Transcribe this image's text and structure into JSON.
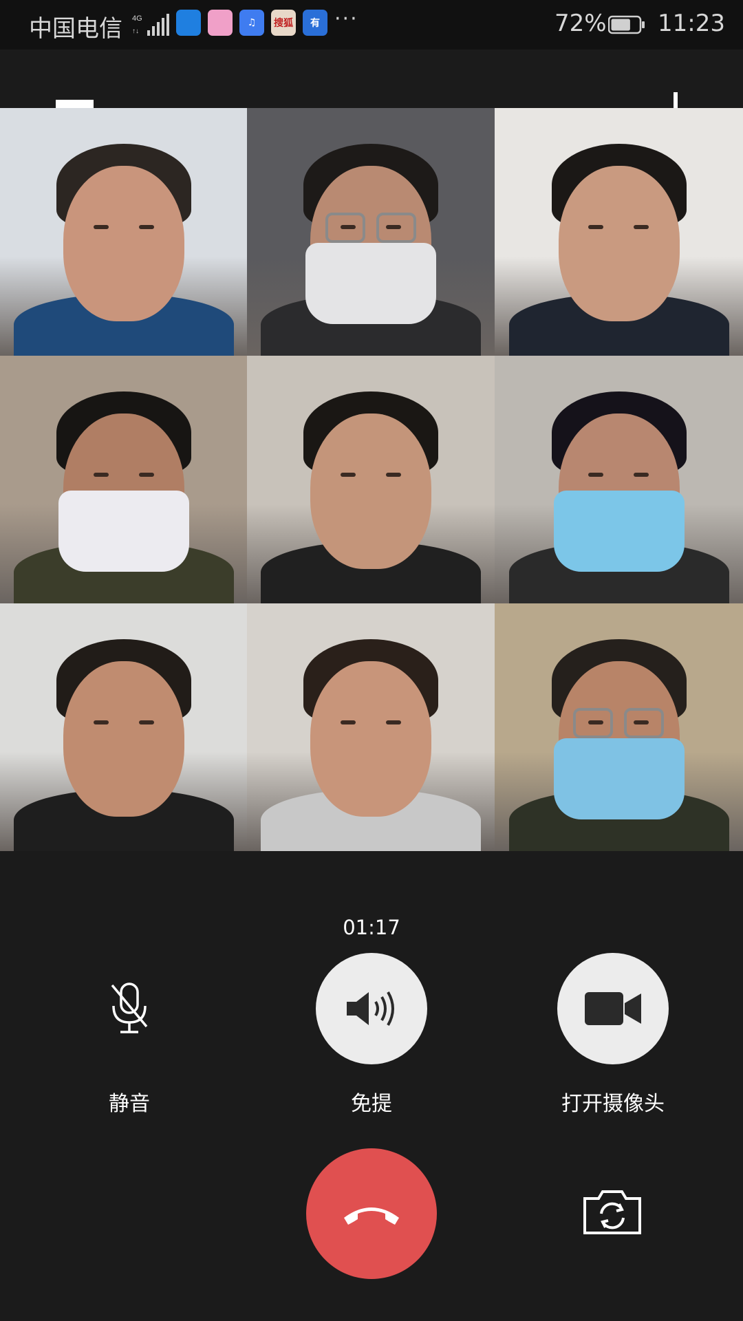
{
  "status_bar": {
    "carrier": "中国电信",
    "network": "4G",
    "notification_icons": [
      {
        "name": "browser-app-icon",
        "color": "#1f7fe0",
        "text": ""
      },
      {
        "name": "gallery-app-icon",
        "color": "#f0a0c8",
        "text": ""
      },
      {
        "name": "music-app-icon",
        "color": "#3f7cf0",
        "text": "♫"
      },
      {
        "name": "sohu-video-app-icon",
        "color": "#e8d8c8",
        "text": "搜狐"
      },
      {
        "name": "news-app-icon",
        "color": "#2a6fd8",
        "text": "有"
      }
    ],
    "more": "···",
    "battery_percent": "72%",
    "battery_level": 0.72,
    "time": "11:23"
  },
  "top_controls": {
    "collapse_icon": "chevron-up-icon",
    "add_icon": "plus-icon"
  },
  "participants": [
    {
      "name": "participant-1",
      "mask": false,
      "glasses": false,
      "bg": "#d9dde2",
      "skin": "#c9957c",
      "hair": "#2c2622",
      "shirt": "#1f4a7a"
    },
    {
      "name": "participant-2",
      "mask": true,
      "mask_color": "#e4e4e6",
      "glasses": true,
      "bg": "#5a5a5e",
      "skin": "#b98a72",
      "hair": "#1d1a18",
      "shirt": "#2b2b2d"
    },
    {
      "name": "participant-3",
      "mask": false,
      "glasses": false,
      "bg": "#e8e6e3",
      "skin": "#c99a80",
      "hair": "#1b1816",
      "shirt": "#1f2530"
    },
    {
      "name": "participant-4",
      "mask": true,
      "mask_color": "#ecebf0",
      "glasses": false,
      "bg": "#a99b8c",
      "skin": "#b07e64",
      "hair": "#171513",
      "shirt": "#3b3d2a"
    },
    {
      "name": "participant-5",
      "mask": false,
      "glasses": false,
      "bg": "#c8c2ba",
      "skin": "#c4957a",
      "hair": "#1a1714",
      "shirt": "#202020"
    },
    {
      "name": "participant-6",
      "mask": true,
      "mask_color": "#7cc6e8",
      "glasses": false,
      "bg": "#bcb8b2",
      "skin": "#b88770",
      "hair": "#15121a",
      "shirt": "#2a2a2a"
    },
    {
      "name": "participant-7",
      "mask": false,
      "glasses": false,
      "bg": "#dcdcda",
      "skin": "#c08c70",
      "hair": "#211c18",
      "shirt": "#1e1e1e"
    },
    {
      "name": "participant-8",
      "mask": false,
      "glasses": false,
      "bg": "#d6d2cc",
      "skin": "#c8957a",
      "hair": "#2a201a",
      "shirt": "#c8c8c8"
    },
    {
      "name": "participant-9",
      "mask": true,
      "mask_color": "#7fc2e4",
      "glasses": true,
      "bg": "#b8a88c",
      "skin": "#b88468",
      "hair": "#25201c",
      "shirt": "#2e3226"
    }
  ],
  "call": {
    "timer": "01:17",
    "controls": [
      {
        "name": "mute-button",
        "icon": "mic-off-icon",
        "label": "静音",
        "active": false
      },
      {
        "name": "speaker-button",
        "icon": "speaker-icon",
        "label": "免提",
        "active": true
      },
      {
        "name": "camera-button",
        "icon": "video-camera-icon",
        "label": "打开摄像头",
        "active": true
      }
    ],
    "hangup_icon": "phone-hangup-icon",
    "flip_camera_icon": "switch-camera-icon",
    "colors": {
      "hangup": "#e05050",
      "active_circle": "#ececec",
      "background": "#1b1b1b"
    }
  }
}
